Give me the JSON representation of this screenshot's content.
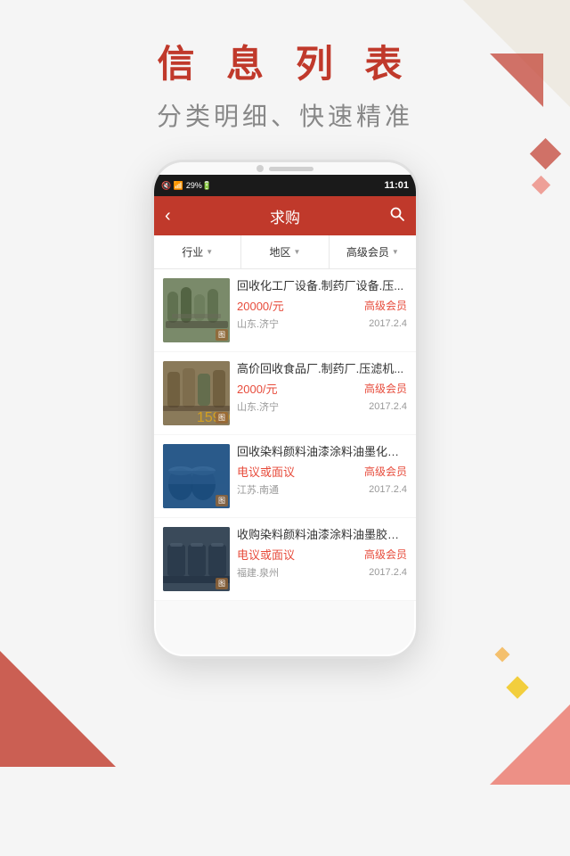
{
  "page": {
    "background_color": "#f2f2f2"
  },
  "header": {
    "main_title": "信 息 列 表",
    "sub_title": "分类明细、快速精准"
  },
  "status_bar": {
    "icons_text": "🔔 📶 29%🔋",
    "time": "11:01"
  },
  "app_bar": {
    "back_label": "‹",
    "title": "求购",
    "search_icon_label": "🔍"
  },
  "filters": [
    {
      "label": "行业",
      "arrow": "▼"
    },
    {
      "label": "地区",
      "arrow": "▼"
    },
    {
      "label": "高级会员",
      "arrow": "▼"
    }
  ],
  "list_items": [
    {
      "title": "回收化工厂设备.制药厂设备.压...",
      "price": "20000/元",
      "member": "高级会员",
      "location": "山东.济宁",
      "date": "2017.2.4",
      "thumb_class": "thumb-1"
    },
    {
      "title": "高价回收食品厂.制药厂.压滤机...",
      "price": "2000/元",
      "member": "高级会员",
      "location": "山东.济宁",
      "date": "2017.2.4",
      "thumb_class": "thumb-2"
    },
    {
      "title": "回收染料颜料油漆涂料油墨化工...",
      "price": "电议或面议",
      "member": "高级会员",
      "location": "江苏.南通",
      "date": "2017.2.4",
      "thumb_class": "thumb-3"
    },
    {
      "title": "收购染料颜料油漆涂料油墨胶印...",
      "price": "电议或面议",
      "member": "高级会员",
      "location": "福建.泉州",
      "date": "2017.2.4",
      "thumb_class": "thumb-4"
    }
  ],
  "thumb_badge": "图"
}
